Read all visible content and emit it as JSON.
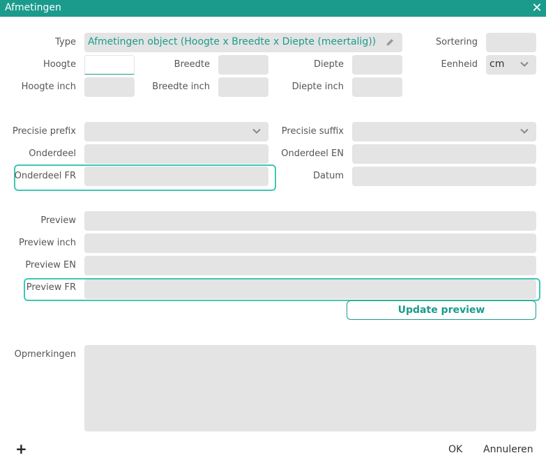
{
  "window": {
    "title": "Afmetingen"
  },
  "labels": {
    "type": "Type",
    "sortering": "Sortering",
    "hoogte": "Hoogte",
    "breedte": "Breedte",
    "diepte": "Diepte",
    "eenheid": "Eenheid",
    "hoogte_inch": "Hoogte inch",
    "breedte_inch": "Breedte inch",
    "diepte_inch": "Diepte inch",
    "precisie_prefix": "Precisie prefix",
    "precisie_suffix": "Precisie suffix",
    "onderdeel": "Onderdeel",
    "onderdeel_en": "Onderdeel EN",
    "onderdeel_fr": "Onderdeel FR",
    "datum": "Datum",
    "preview": "Preview",
    "preview_inch": "Preview inch",
    "preview_en": "Preview EN",
    "preview_fr": "Preview FR",
    "opmerkingen": "Opmerkingen"
  },
  "values": {
    "type": "Afmetingen object (Hoogte x Breedte x Diepte (meertalig))",
    "eenheid": "cm"
  },
  "buttons": {
    "update_preview": "Update preview",
    "add": "+",
    "ok": "OK",
    "annuleren": "Annuleren"
  },
  "icons": {
    "close": "close-icon",
    "edit": "pencil-icon",
    "dropdown": "chevron-down-icon",
    "add": "plus-icon"
  },
  "colors": {
    "accent": "#1a9b8c",
    "highlight": "#3fc7b3",
    "field": "#e4e4e4"
  }
}
